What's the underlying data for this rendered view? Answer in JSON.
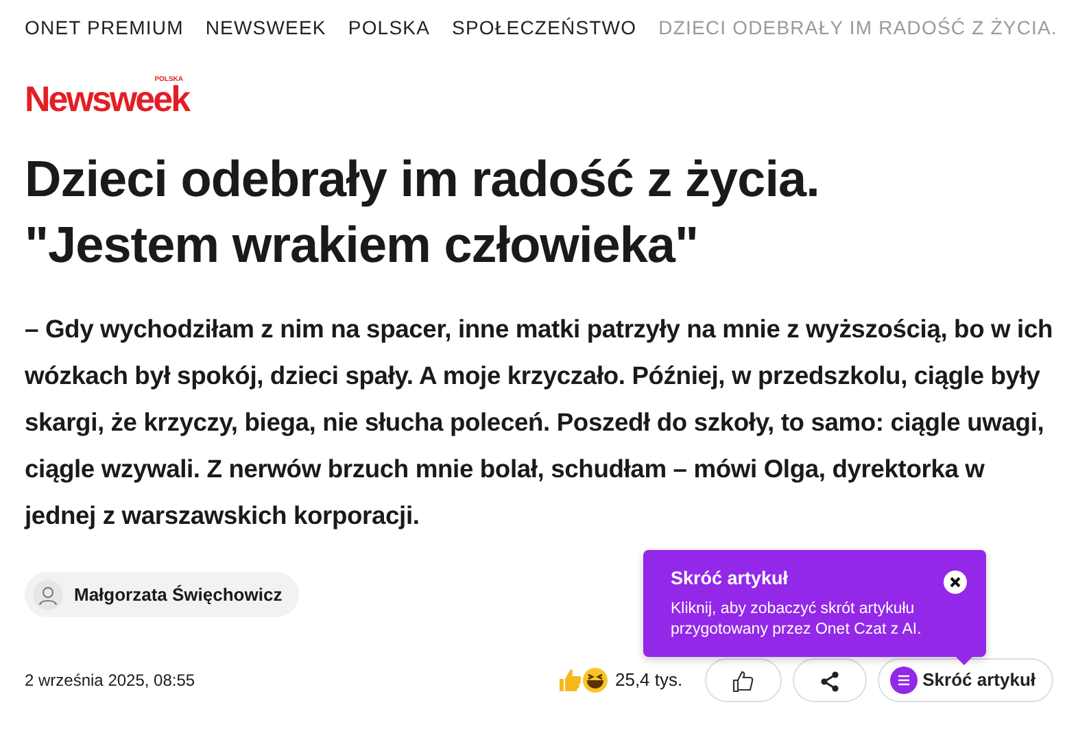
{
  "breadcrumb": [
    {
      "label": "ONET PREMIUM",
      "current": false
    },
    {
      "label": "NEWSWEEK",
      "current": false
    },
    {
      "label": "POLSKA",
      "current": false
    },
    {
      "label": "SPOŁECZEŃSTWO",
      "current": false
    },
    {
      "label": "DZIECI ODEBRAŁY IM RADOŚĆ Z ŻYCIA.",
      "current": true
    }
  ],
  "logo": {
    "name": "Newsweek",
    "edition": "POLSKA"
  },
  "title": "Dzieci odebrały im radość z życia. \"Jestem wrakiem człowieka\"",
  "lead": "– Gdy wychodziłam z nim na spacer, inne matki patrzyły na mnie z wyższością, bo w ich wózkach był spokój, dzieci spały. A moje krzyczało. Później, w przedszkolu, ciągle były skargi, że krzyczy, biega, nie słucha poleceń. Poszedł do szkoły, to samo: ciągle uwagi, ciągle wzywali. Z nerwów brzuch mnie bolał, schudłam – mówi Olga, dyrektorka w jednej z warszawskich korporacji.",
  "author": "Małgorzata Święchowicz",
  "date": "2 września 2025, 08:55",
  "reactions": {
    "count": "25,4 tys."
  },
  "summary_button": "Skróć artykuł",
  "tooltip": {
    "title": "Skróć artykuł",
    "text": "Kliknij, aby zobaczyć skrót artykułu przygotowany przez Onet Czat z AI."
  }
}
